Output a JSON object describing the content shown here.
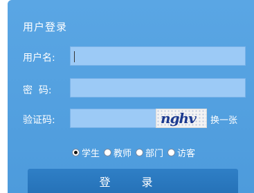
{
  "login": {
    "title": "用户登录",
    "username_label": "用户名:",
    "username_value": "",
    "password_label": "密  码:",
    "password_value": "",
    "captcha_label": "验证码:",
    "captcha_value": "",
    "captcha_image_text": "nghv",
    "refresh_label": "换一张",
    "roles": [
      {
        "label": "学生",
        "checked": true
      },
      {
        "label": "教师",
        "checked": false
      },
      {
        "label": "部门",
        "checked": false
      },
      {
        "label": "访客",
        "checked": false
      }
    ],
    "submit_label": "登 录"
  }
}
